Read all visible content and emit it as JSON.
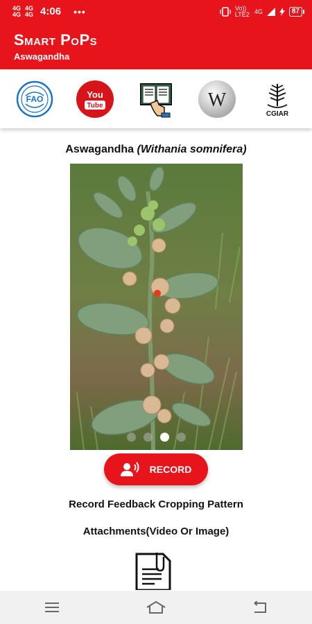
{
  "status_bar": {
    "network_top": "4G",
    "network_bottom": "4G",
    "network2_top": "4G",
    "network2_bottom": "4G",
    "time": "4:06",
    "more": "•••",
    "carrier_info": "Vo)) LTE2",
    "signal": "4G",
    "battery": "87"
  },
  "app_bar": {
    "title": "Smart PoPs",
    "subtitle": "Aswagandha"
  },
  "links": [
    {
      "name": "fao-logo",
      "label": "FAO"
    },
    {
      "name": "youtube-logo",
      "label": "You Tube"
    },
    {
      "name": "book-reader-icon",
      "label": ""
    },
    {
      "name": "wikipedia-logo",
      "label": "W"
    },
    {
      "name": "cgiar-logo",
      "label": "CGIAR"
    }
  ],
  "plant": {
    "common_name": "Aswagandha",
    "scientific_name": "(Withania somnifera)"
  },
  "carousel": {
    "slide_count": 4,
    "active_index": 2
  },
  "record_button": {
    "label": "RECORD"
  },
  "feedback": {
    "line1": "Record Feedback Cropping Pattern",
    "line2": "Attachments(Video Or Image)"
  },
  "colors": {
    "primary": "#e8141b",
    "nav_bg": "#f1f1f1"
  }
}
